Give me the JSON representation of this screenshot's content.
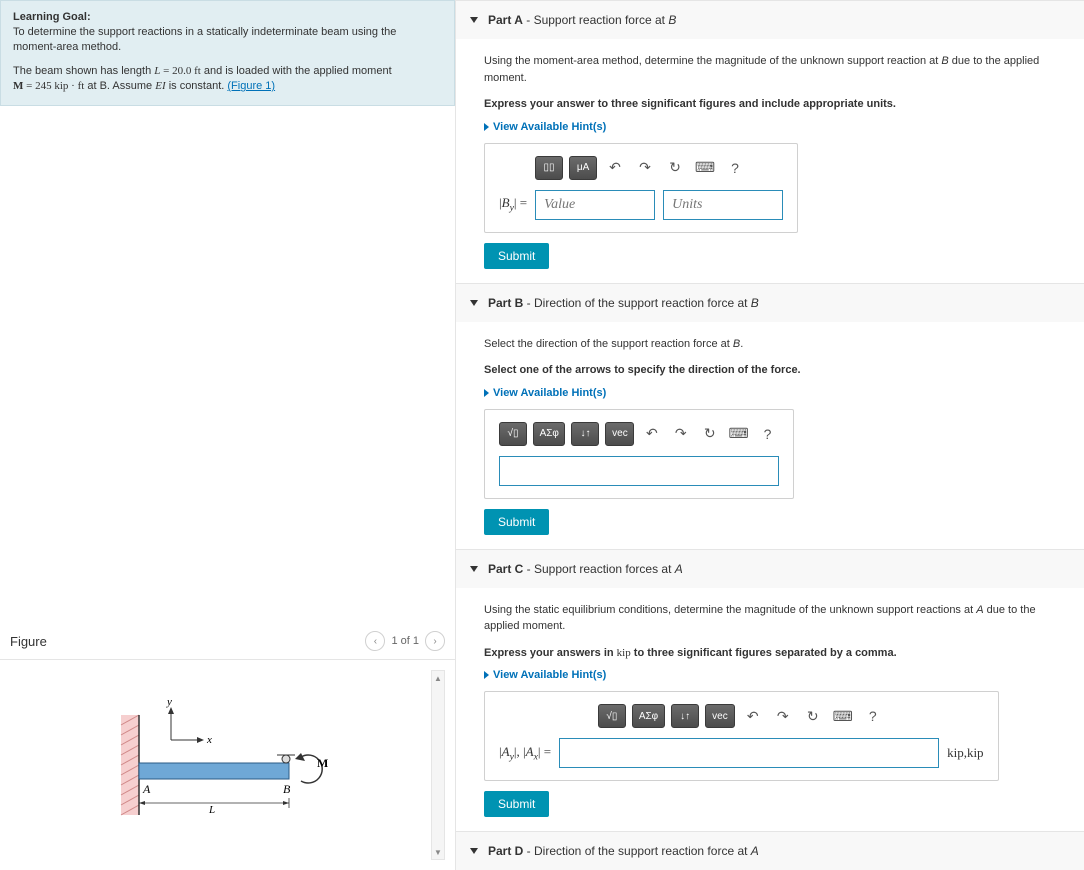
{
  "learning_goal": {
    "title": "Learning Goal:",
    "para1": "To determine the support reactions in a statically indeterminate beam using the moment-area method.",
    "para2_prefix": "The beam shown has length ",
    "L_eq": "L = 20.0 ft",
    "para2_mid": " and is loaded with the applied moment ",
    "M_eq": "M = 245 kip · ft",
    "para2_mid2": " at B. Assume ",
    "EI": "EI",
    "para2_end": " is constant. ",
    "figure_link": "(Figure 1)"
  },
  "figure": {
    "heading": "Figure",
    "pager": "1 of 1",
    "labels": {
      "y": "y",
      "x": "x",
      "A": "A",
      "B": "B",
      "L": "L",
      "M": "M"
    }
  },
  "partA": {
    "label": "Part A",
    "subtitle": " - Support reaction force at ",
    "point": "B",
    "p1": "Using the moment-area method, determine the magnitude of the unknown support reaction at B due to the applied moment.",
    "p2": "Express your answer to three significant figures and include appropriate units.",
    "hints": "View Available Hint(s)",
    "toolbar": {
      "b1": "▯▯",
      "b2": "μA"
    },
    "ans_label": "|B_y| =",
    "value_ph": "Value",
    "units_ph": "Units",
    "submit": "Submit"
  },
  "partB": {
    "label": "Part B",
    "subtitle": " - Direction of the support reaction force at ",
    "point": "B",
    "p1": "Select the direction of the support reaction force at B.",
    "p2": "Select one of the arrows to specify the direction of the force.",
    "hints": "View Available Hint(s)",
    "toolbar": {
      "b1": "√▯",
      "b2": "ΑΣφ",
      "b3": "↓↑",
      "b4": "vec"
    },
    "submit": "Submit"
  },
  "partC": {
    "label": "Part C",
    "subtitle": " - Support reaction forces at ",
    "point": "A",
    "p1": "Using the static equilibrium conditions, determine the magnitude of the unknown support reactions at A due to the applied moment.",
    "p2_pre": "Express your answers in ",
    "p2_unit": "kip",
    "p2_post": " to three significant figures separated by a comma.",
    "hints": "View Available Hint(s)",
    "toolbar": {
      "b1": "√▯",
      "b2": "ΑΣφ",
      "b3": "↓↑",
      "b4": "vec"
    },
    "ans_label": "|A_y|, |A_x| =",
    "units_suffix": "kip,kip",
    "submit": "Submit"
  },
  "partD": {
    "label": "Part D",
    "subtitle": " - Direction of the support reaction force at ",
    "point": "A"
  },
  "icons": {
    "undo": "↶",
    "redo": "↷",
    "reset": "↻",
    "keyboard": "⌨",
    "help": "?"
  }
}
